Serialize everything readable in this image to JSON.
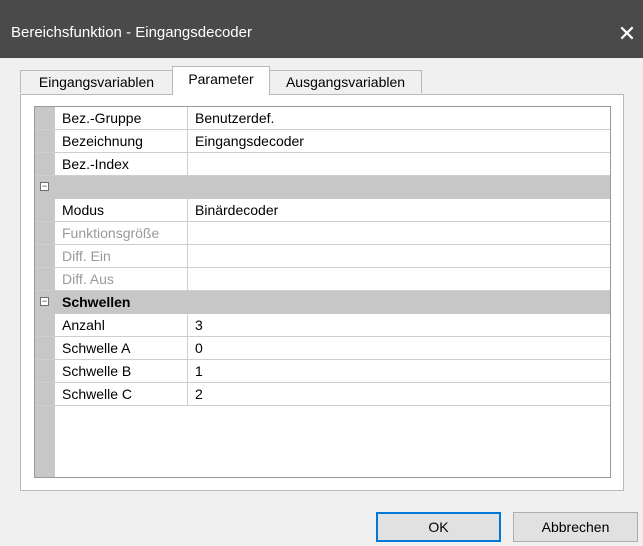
{
  "window": {
    "title": "Bereichsfunktion - Eingangsdecoder",
    "close_icon": "close-icon"
  },
  "tabs": [
    {
      "label": "Eingangsvariablen",
      "active": false
    },
    {
      "label": "Parameter",
      "active": true
    },
    {
      "label": "Ausgangsvariablen",
      "active": false
    }
  ],
  "params": {
    "rows": [
      {
        "name": "Bez.-Gruppe",
        "value": "Benutzerdef."
      },
      {
        "name": "Bezeichnung",
        "value": "Eingangsdecoder"
      },
      {
        "name": "Bez.-Index",
        "value": ""
      }
    ],
    "group1": {
      "title": "",
      "toggle": "⊟"
    },
    "rows2": [
      {
        "name": "Modus",
        "value": "Binärdecoder"
      },
      {
        "name": "Funktionsgröße",
        "value": ""
      },
      {
        "name": "Diff. Ein",
        "value": ""
      },
      {
        "name": "Diff. Aus",
        "value": ""
      }
    ],
    "group2": {
      "title": "Schwellen",
      "toggle": "⊟"
    },
    "rows3": [
      {
        "name": "Anzahl",
        "value": "3"
      },
      {
        "name": "Schwelle A",
        "value": "0"
      },
      {
        "name": "Schwelle B",
        "value": "1"
      },
      {
        "name": "Schwelle C",
        "value": "2"
      }
    ]
  },
  "buttons": {
    "ok": "OK",
    "cancel": "Abbrechen"
  },
  "colors": {
    "titlebar": "#4a4a4a",
    "accent": "#0078d7",
    "gutter": "#c7c7c7"
  }
}
